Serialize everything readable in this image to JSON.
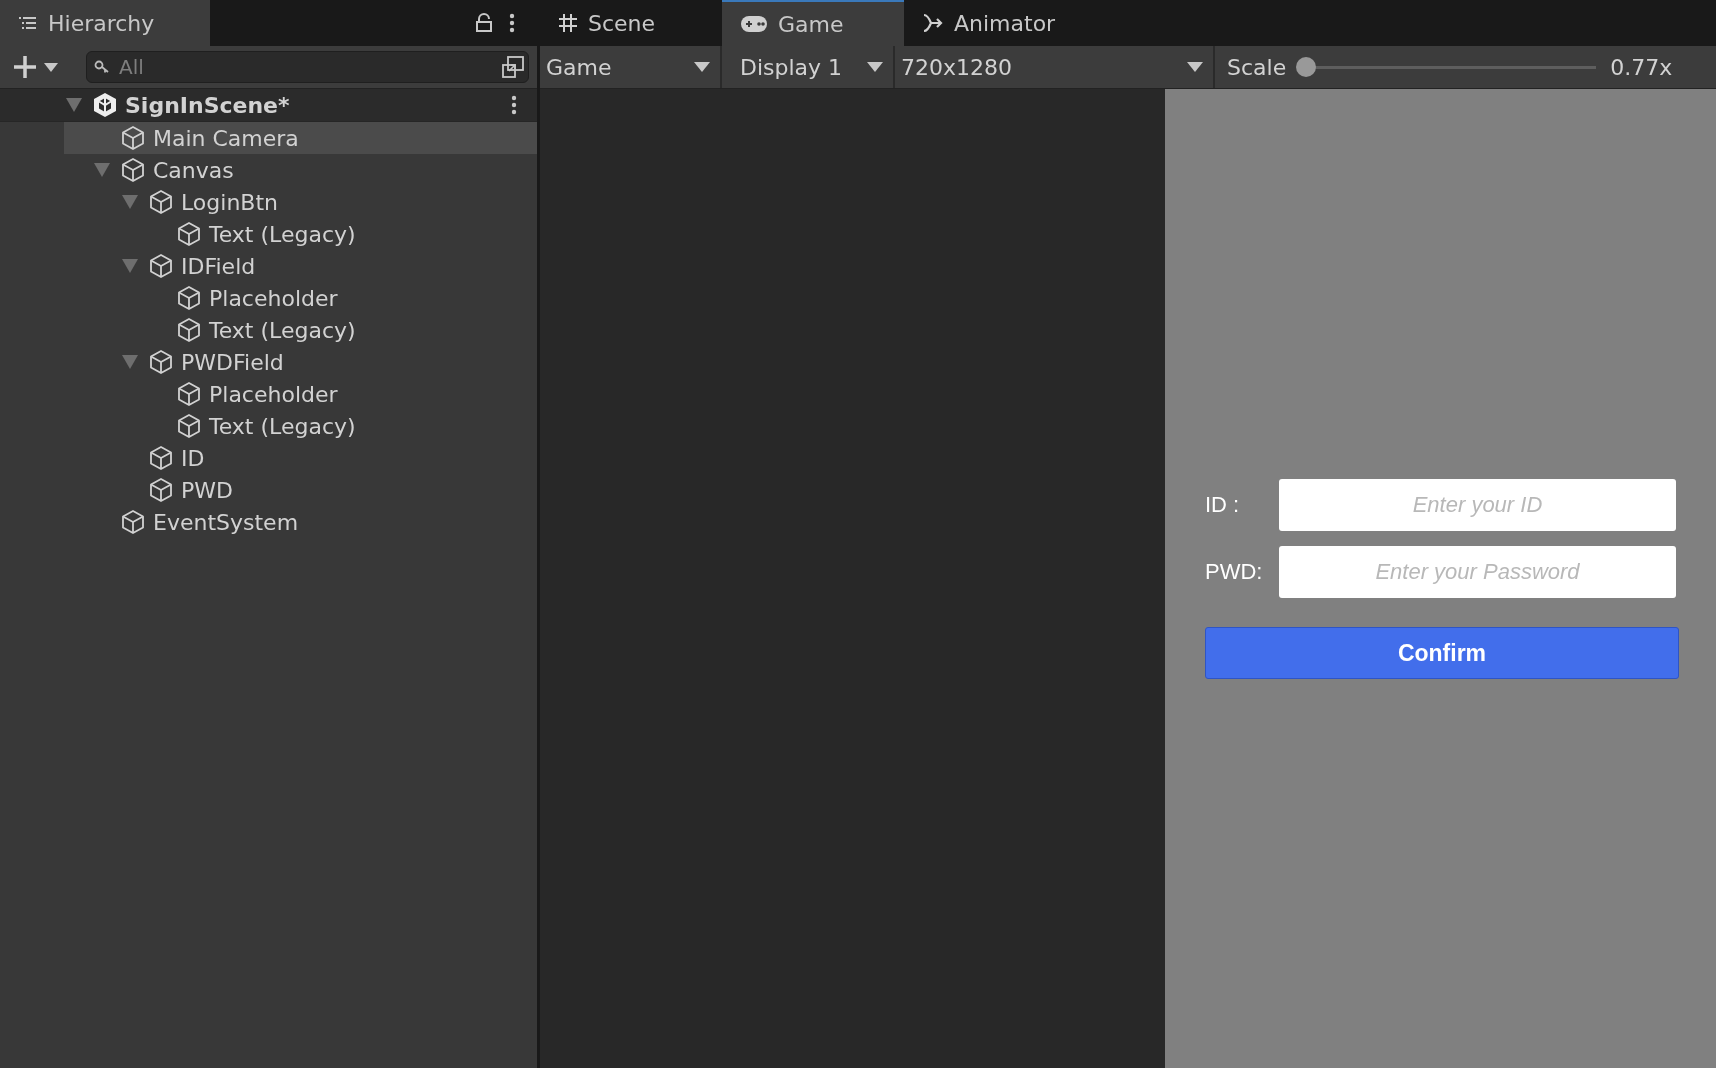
{
  "hierarchy": {
    "tab": {
      "label": "Hierarchy"
    },
    "search": {
      "placeholder": "All"
    },
    "tree": [
      {
        "label": "SignInScene*",
        "kind": "scene",
        "expanded": true,
        "selected": false,
        "children": [
          {
            "label": "Main Camera",
            "kind": "object",
            "selected": true
          },
          {
            "label": "Canvas",
            "kind": "object",
            "expanded": true,
            "selected": false,
            "children": [
              {
                "label": "LoginBtn",
                "kind": "object",
                "expanded": true,
                "selected": false,
                "children": [
                  {
                    "label": "Text (Legacy)",
                    "kind": "object",
                    "selected": false
                  }
                ]
              },
              {
                "label": "IDField",
                "kind": "object",
                "expanded": true,
                "selected": false,
                "children": [
                  {
                    "label": "Placeholder",
                    "kind": "object",
                    "selected": false
                  },
                  {
                    "label": "Text (Legacy)",
                    "kind": "object",
                    "selected": false
                  }
                ]
              },
              {
                "label": "PWDField",
                "kind": "object",
                "expanded": true,
                "selected": false,
                "children": [
                  {
                    "label": "Placeholder",
                    "kind": "object",
                    "selected": false
                  },
                  {
                    "label": "Text (Legacy)",
                    "kind": "object",
                    "selected": false
                  }
                ]
              },
              {
                "label": "ID",
                "kind": "object",
                "selected": false
              },
              {
                "label": "PWD",
                "kind": "object",
                "selected": false
              }
            ]
          },
          {
            "label": "EventSystem",
            "kind": "object",
            "selected": false
          }
        ]
      }
    ]
  },
  "tabs": [
    {
      "label": "Scene",
      "kind": "scene",
      "selected": false
    },
    {
      "label": "Game",
      "kind": "game",
      "selected": true
    },
    {
      "label": "Animator",
      "kind": "animator",
      "selected": false
    }
  ],
  "toolbar": {
    "view": "Game",
    "display": "Display 1",
    "resolution": "720x1280",
    "scale_label": "Scale",
    "scale": {
      "level": 0.0
    },
    "scale_reading": "0.77x"
  },
  "game": {
    "fields": [
      {
        "label": "ID :",
        "placeholder": "Enter your ID"
      },
      {
        "label": "PWD:",
        "placeholder": "Enter your Password"
      }
    ],
    "button": "Confirm"
  }
}
